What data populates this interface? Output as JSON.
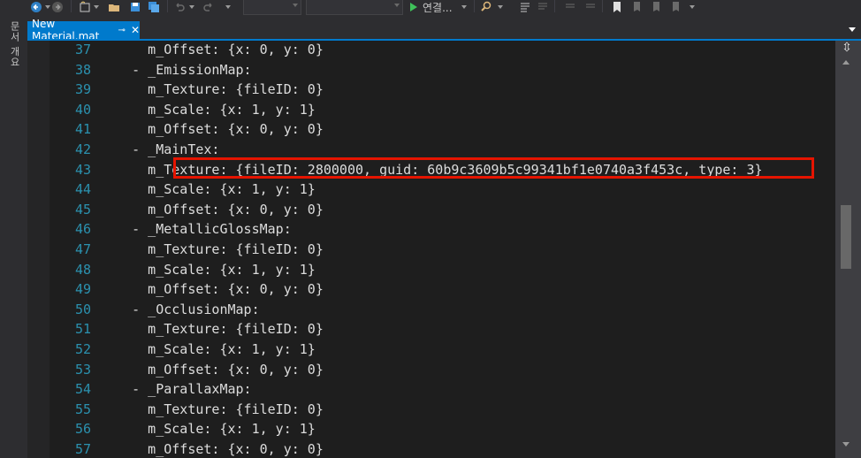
{
  "toolbar": {
    "start_label": "연결...",
    "icons": [
      "back-icon",
      "forward-icon",
      "new-project-icon",
      "open-file-icon",
      "save-icon",
      "save-all-icon",
      "undo-icon",
      "redo-icon",
      "start-icon",
      "find-icon",
      "comment-icon",
      "uncomment-icon",
      "bookmark-icon"
    ]
  },
  "left_strip": {
    "doc_outline_label": "문서 개요"
  },
  "tab": {
    "title": "New Material.mat",
    "pin_glyph": "⊸",
    "close_glyph": "✕"
  },
  "editor": {
    "lines": [
      {
        "num": "37",
        "text": "      m_Offset: {x: 0, y: 0}"
      },
      {
        "num": "38",
        "text": "    - _EmissionMap:"
      },
      {
        "num": "39",
        "text": "      m_Texture: {fileID: 0}"
      },
      {
        "num": "40",
        "text": "      m_Scale: {x: 1, y: 1}"
      },
      {
        "num": "41",
        "text": "      m_Offset: {x: 0, y: 0}"
      },
      {
        "num": "42",
        "text": "    - _MainTex:"
      },
      {
        "num": "43",
        "text": "      m_Texture: {fileID: 2800000, guid: 60b9c3609b5c99341bf1e0740a3f453c, type: 3}"
      },
      {
        "num": "44",
        "text": "      m_Scale: {x: 1, y: 1}"
      },
      {
        "num": "45",
        "text": "      m_Offset: {x: 0, y: 0}"
      },
      {
        "num": "46",
        "text": "    - _MetallicGlossMap:"
      },
      {
        "num": "47",
        "text": "      m_Texture: {fileID: 0}"
      },
      {
        "num": "48",
        "text": "      m_Scale: {x: 1, y: 1}"
      },
      {
        "num": "49",
        "text": "      m_Offset: {x: 0, y: 0}"
      },
      {
        "num": "50",
        "text": "    - _OcclusionMap:"
      },
      {
        "num": "51",
        "text": "      m_Texture: {fileID: 0}"
      },
      {
        "num": "52",
        "text": "      m_Scale: {x: 1, y: 1}"
      },
      {
        "num": "53",
        "text": "      m_Offset: {x: 0, y: 0}"
      },
      {
        "num": "54",
        "text": "    - _ParallaxMap:"
      },
      {
        "num": "55",
        "text": "      m_Texture: {fileID: 0}"
      },
      {
        "num": "56",
        "text": "      m_Scale: {x: 1, y: 1}"
      },
      {
        "num": "57",
        "text": "      m_Offset: {x: 0, y: 0}"
      }
    ],
    "highlighted_line": "43"
  },
  "colors": {
    "accent": "#007acc",
    "highlight_border": "#e51400",
    "line_number": "#2b91af",
    "editor_bg": "#1e1e1e",
    "code_text": "#dcdcdc"
  }
}
